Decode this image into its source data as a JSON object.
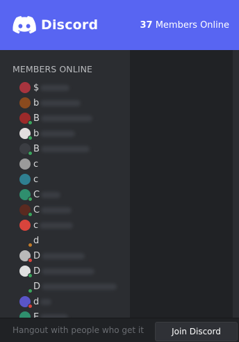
{
  "header": {
    "brand": "Discord",
    "online_count": "37",
    "online_label": "Members Online"
  },
  "members_title": "MEMBERS ONLINE",
  "members": [
    {
      "initial": "$",
      "avatar_color": "#a8343e",
      "status_color": "",
      "blur_width": 42
    },
    {
      "initial": "b",
      "avatar_color": "#8a4a1e",
      "status_color": "",
      "blur_width": 58
    },
    {
      "initial": "B",
      "avatar_color": "#9c2a2a",
      "status_color": "#3ba55d",
      "blur_width": 74
    },
    {
      "initial": "b",
      "avatar_color": "#e3dede",
      "status_color": "#3ba55d",
      "blur_width": 50
    },
    {
      "initial": "B",
      "avatar_color": "#3b3d42",
      "status_color": "#3ba55d",
      "blur_width": 70
    },
    {
      "initial": "c",
      "avatar_color": "#9a9a9a",
      "status_color": "",
      "blur_width": 0
    },
    {
      "initial": "c",
      "avatar_color": "#2f7f91",
      "status_color": "",
      "blur_width": 0
    },
    {
      "initial": "C",
      "avatar_color": "#2f8f6e",
      "status_color": "#3ba55d",
      "blur_width": 28
    },
    {
      "initial": "C",
      "avatar_color": "#5a2a20",
      "status_color": "#3ba55d",
      "blur_width": 44
    },
    {
      "initial": "c",
      "avatar_color": "#d8443c",
      "status_color": "",
      "blur_width": 48
    },
    {
      "initial": "d",
      "avatar_color": "",
      "status_color": "#c27b2a",
      "blur_width": 0
    },
    {
      "initial": "D",
      "avatar_color": "#b9b9b9",
      "status_color": "#d8443c",
      "blur_width": 62
    },
    {
      "initial": "D",
      "avatar_color": "#e0e0e0",
      "status_color": "#3ba55d",
      "blur_width": 76
    },
    {
      "initial": "D",
      "avatar_color": "",
      "status_color": "#3ba55d",
      "blur_width": 108
    },
    {
      "initial": "d",
      "avatar_color": "#5a55c8",
      "status_color": "#d8443c",
      "blur_width": 16
    },
    {
      "initial": "E",
      "avatar_color": "#2f8f6e",
      "status_color": "",
      "blur_width": 40
    }
  ],
  "footer": {
    "tagline": "Hangout with people who get it",
    "join_label": "Join Discord"
  }
}
